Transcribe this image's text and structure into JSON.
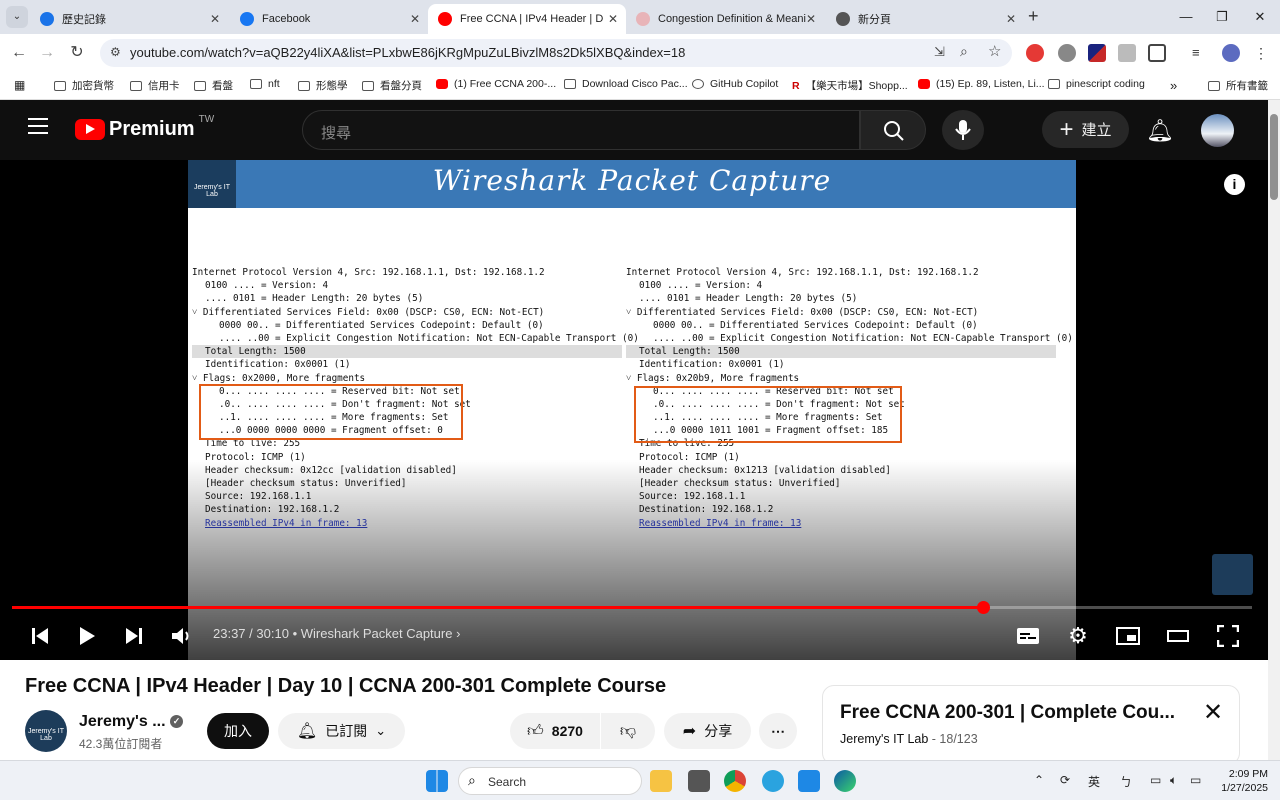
{
  "browser": {
    "tabs": [
      {
        "title": "歷史記錄",
        "active": false,
        "favicon_color": "#1a73e8"
      },
      {
        "title": "Facebook",
        "active": false,
        "favicon_color": "#1877f2"
      },
      {
        "title": "Free CCNA | IPv4 Header | D",
        "active": true,
        "favicon_color": "#ff0000"
      },
      {
        "title": "Congestion Definition & Meani",
        "active": false,
        "favicon_color": "#e8b4b8"
      },
      {
        "title": "新分頁",
        "active": false,
        "favicon_color": "#555555"
      }
    ],
    "new_tab_label": "+",
    "url": "youtube.com/watch?v=aQB22y4liXA&list=PLxbwE86jKRgMpuZuLBivzlM8s2Dk5lXBQ&index=18",
    "bookmarks": [
      "加密貨幣",
      "信用卡",
      "看盤",
      "nft",
      "形態學",
      "看盤分頁",
      "(1) Free CCNA 200-...",
      "Download Cisco Pac...",
      "GitHub Copilot",
      "【樂天市場】Shopp...",
      "(15) Ep. 89, Listen, Li...",
      "pinescript coding"
    ],
    "bookmarks_overflow": "»",
    "all_bookmarks": "所有書籤"
  },
  "youtube": {
    "logo_text": "Premium",
    "logo_region": "TW",
    "search_placeholder": "搜尋",
    "create_label": "建立",
    "video": {
      "slide_title": "Wireshark Packet Capture",
      "slide_logo_text": "Jeremy's IT Lab",
      "left_packet": [
        {
          "text": "Internet Protocol Version 4, Src: 192.168.1.1, Dst: 192.168.1.2",
          "indent": 0
        },
        {
          "text": "0100 .... = Version: 4",
          "indent": 1
        },
        {
          "text": ".... 0101 = Header Length: 20 bytes (5)",
          "indent": 1
        },
        {
          "text": "˅ Differentiated Services Field: 0x00 (DSCP: CS0, ECN: Not-ECT)",
          "indent": 0
        },
        {
          "text": "0000 00.. = Differentiated Services Codepoint: Default (0)",
          "indent": 2
        },
        {
          "text": ".... ..00 = Explicit Congestion Notification: Not ECN-Capable Transport (0)",
          "indent": 2
        },
        {
          "text": "Total Length: 1500",
          "indent": 1,
          "highlight": true
        },
        {
          "text": "Identification: 0x0001 (1)",
          "indent": 1
        },
        {
          "text": "˅ Flags: 0x2000, More fragments",
          "indent": 0
        },
        {
          "text": "0... .... .... .... = Reserved bit: Not set",
          "indent": 2
        },
        {
          "text": ".0.. .... .... .... = Don't fragment: Not set",
          "indent": 2
        },
        {
          "text": "..1. .... .... .... = More fragments: Set",
          "indent": 2
        },
        {
          "text": "...0 0000 0000 0000 = Fragment offset: 0",
          "indent": 2
        },
        {
          "text": "Time to live: 255",
          "indent": 1
        },
        {
          "text": "Protocol: ICMP (1)",
          "indent": 1
        },
        {
          "text": "Header checksum: 0x12cc [validation disabled]",
          "indent": 1
        },
        {
          "text": "[Header checksum status: Unverified]",
          "indent": 1
        },
        {
          "text": "Source: 192.168.1.1",
          "indent": 1
        },
        {
          "text": "Destination: 192.168.1.2",
          "indent": 1
        },
        {
          "text": "Reassembled IPv4 in frame: 13",
          "indent": 1,
          "link": true
        }
      ],
      "right_packet": [
        {
          "text": "Internet Protocol Version 4, Src: 192.168.1.1, Dst: 192.168.1.2",
          "indent": 0
        },
        {
          "text": "0100 .... = Version: 4",
          "indent": 1
        },
        {
          "text": ".... 0101 = Header Length: 20 bytes (5)",
          "indent": 1
        },
        {
          "text": "˅ Differentiated Services Field: 0x00 (DSCP: CS0, ECN: Not-ECT)",
          "indent": 0
        },
        {
          "text": "0000 00.. = Differentiated Services Codepoint: Default (0)",
          "indent": 2
        },
        {
          "text": ".... ..00 = Explicit Congestion Notification: Not ECN-Capable Transport (0)",
          "indent": 2
        },
        {
          "text": "Total Length: 1500",
          "indent": 1,
          "highlight": true
        },
        {
          "text": "Identification: 0x0001 (1)",
          "indent": 1
        },
        {
          "text": "˅ Flags: 0x20b9, More fragments",
          "indent": 0
        },
        {
          "text": "0... .... .... .... = Reserved bit: Not set",
          "indent": 2
        },
        {
          "text": ".0.. .... .... .... = Don't fragment: Not set",
          "indent": 2
        },
        {
          "text": "..1. .... .... .... = More fragments: Set",
          "indent": 2
        },
        {
          "text": "...0 0000 1011 1001 = Fragment offset: 185",
          "indent": 2
        },
        {
          "text": "Time to live: 255",
          "indent": 1
        },
        {
          "text": "Protocol: ICMP (1)",
          "indent": 1
        },
        {
          "text": "Header checksum: 0x1213 [validation disabled]",
          "indent": 1
        },
        {
          "text": "[Header checksum status: Unverified]",
          "indent": 1
        },
        {
          "text": "Source: 192.168.1.1",
          "indent": 1
        },
        {
          "text": "Destination: 192.168.1.2",
          "indent": 1
        },
        {
          "text": "Reassembled IPv4 in frame: 13",
          "indent": 1,
          "link": true
        }
      ],
      "highlight_color": "#e25b16",
      "time_current": "23:37",
      "time_total": "30:10",
      "chapter": "Wireshark Packet Capture",
      "progress_fraction": 0.783
    },
    "title": "Free CCNA | IPv4 Header | Day 10 | CCNA 200-301 Complete Course",
    "channel": {
      "name": "Jeremy's ...",
      "subscribers": "42.3萬位訂閱者",
      "avatar_text": "Jeremy's IT Lab"
    },
    "join_label": "加入",
    "subscribed_label": "已訂閱",
    "likes": "8270",
    "share_label": "分享",
    "playlist": {
      "title": "Free CCNA 200-301 | Complete Cou...",
      "owner": "Jeremy's IT Lab",
      "position": "18/123"
    }
  },
  "taskbar": {
    "search_label": "Search",
    "ime": "英",
    "time": "2:09 PM",
    "date": "1/27/2025"
  }
}
